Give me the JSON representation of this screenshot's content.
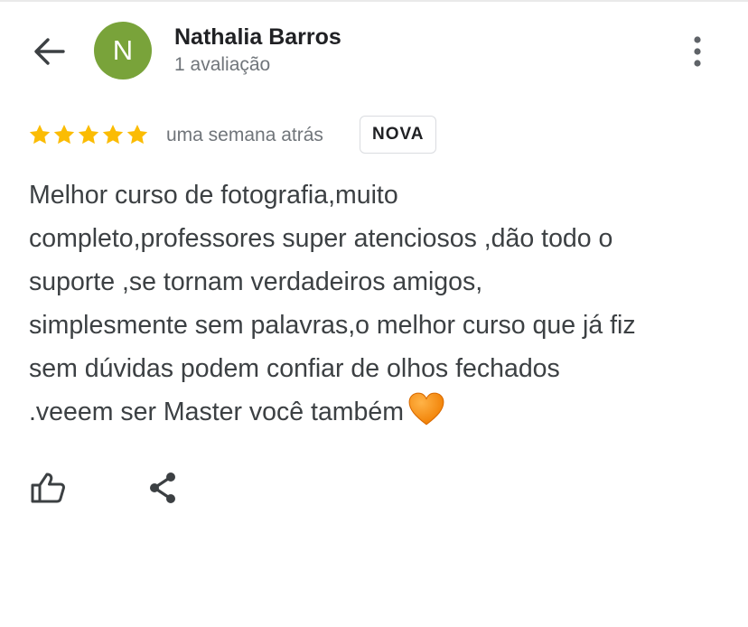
{
  "header": {
    "back_icon": "arrow-left-icon",
    "avatar_initial": "N",
    "avatar_color": "#79a33a",
    "name": "Nathalia Barros",
    "subtitle": "1 avaliação",
    "more_icon": "more-vert-icon"
  },
  "review": {
    "rating": 5,
    "rating_max": 5,
    "star_color": "#fbbc04",
    "date": "uma semana atrás",
    "badge": "NOVA",
    "text_lines": [
      "Melhor curso de fotografia,muito",
      "completo,professores super atenciosos ,dão todo o",
      "suporte ,se tornam verdadeiros amigos,",
      "simplesmente sem palavras,o melhor curso que já fiz",
      "sem dúvidas podem confiar de olhos fechados",
      ".veeem ser Master você também"
    ],
    "emoji": "orange-heart-icon"
  },
  "actions": {
    "like_icon": "thumbs-up-icon",
    "share_icon": "share-icon"
  }
}
